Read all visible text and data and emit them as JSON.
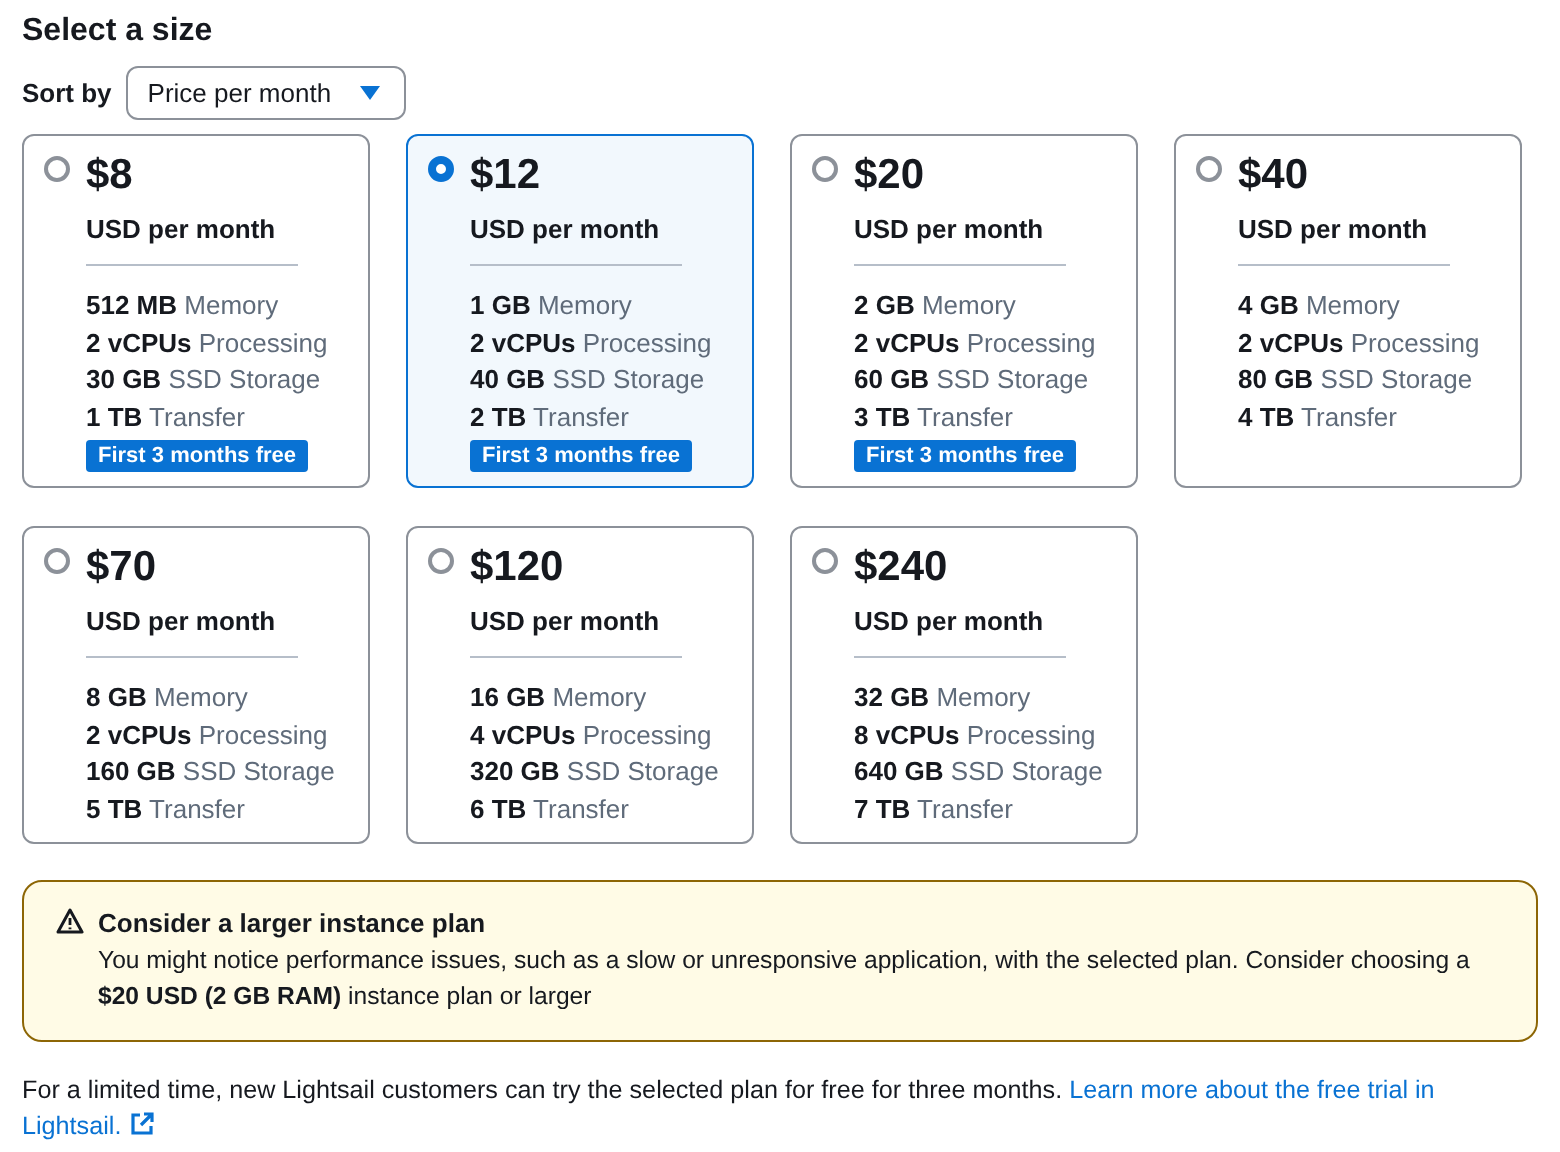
{
  "title": "Select a size",
  "sort": {
    "label": "Sort by",
    "value": "Price per month"
  },
  "plans": [
    {
      "price": "$8",
      "period": "USD per month",
      "selected": false,
      "specs": [
        "**512 MB** Memory",
        "**2 vCPUs** Processing",
        "**30 GB** SSD Storage",
        "**1 TB** Transfer"
      ],
      "badge": "First 3 months free"
    },
    {
      "price": "$12",
      "period": "USD per month",
      "selected": true,
      "specs": [
        "**1 GB** Memory",
        "**2 vCPUs** Processing",
        "**40 GB** SSD Storage",
        "**2 TB** Transfer"
      ],
      "badge": "First 3 months free"
    },
    {
      "price": "$20",
      "period": "USD per month",
      "selected": false,
      "specs": [
        "**2 GB** Memory",
        "**2 vCPUs** Processing",
        "**60 GB** SSD Storage",
        "**3 TB** Transfer"
      ],
      "badge": "First 3 months free"
    },
    {
      "price": "$40",
      "period": "USD per month",
      "selected": false,
      "specs": [
        "**4 GB** Memory",
        "**2 vCPUs** Processing",
        "**80 GB** SSD Storage",
        "**4 TB** Transfer"
      ]
    },
    {
      "price": "$70",
      "period": "USD per month",
      "selected": false,
      "specs": [
        "**8 GB** Memory",
        "**2 vCPUs** Processing",
        "**160 GB** SSD Storage",
        "**5 TB** Transfer"
      ]
    },
    {
      "price": "$120",
      "period": "USD per month",
      "selected": false,
      "specs": [
        "**16 GB** Memory",
        "**4 vCPUs** Processing",
        "**320 GB** SSD Storage",
        "**6 TB** Transfer"
      ]
    },
    {
      "price": "$240",
      "period": "USD per month",
      "selected": false,
      "specs": [
        "**32 GB** Memory",
        "**8 vCPUs** Processing",
        "**640 GB** SSD Storage",
        "**7 TB** Transfer"
      ]
    }
  ],
  "warning": {
    "title": "Consider a larger instance plan",
    "message": "You might notice performance issues, such as a slow or unresponsive application, with the selected plan. Consider choosing a **$20 USD (2 GB RAM)** instance plan or larger"
  },
  "footer": {
    "text": "For a limited time, new Lightsail customers can try the selected plan for free for three months.",
    "link_parts": [
      "Learn more about the free trial in",
      "Lightsail."
    ]
  }
}
